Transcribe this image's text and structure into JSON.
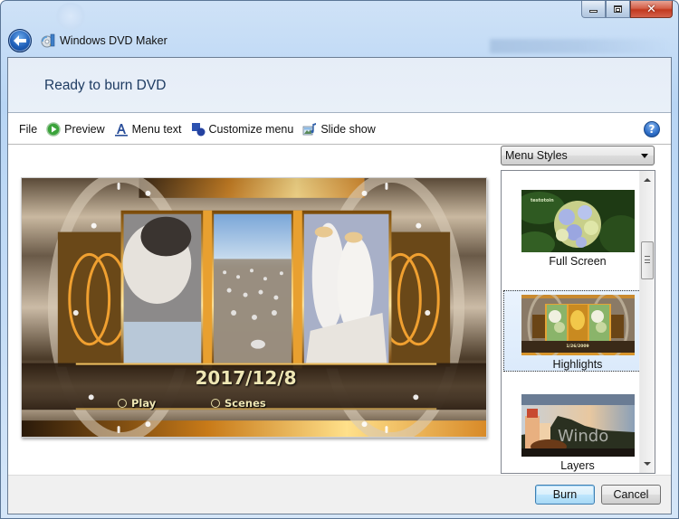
{
  "window": {
    "title": "Windows DVD Maker",
    "controls": {
      "minimize": "minimize",
      "maximize": "maximize",
      "close": "close"
    }
  },
  "header": {
    "title": "Ready to burn DVD"
  },
  "toolbar": {
    "items": [
      {
        "label": "File",
        "icon": "none"
      },
      {
        "label": "Preview",
        "icon": "play-circle-icon"
      },
      {
        "label": "Menu text",
        "icon": "text-a-icon"
      },
      {
        "label": "Customize menu",
        "icon": "shapes-icon"
      },
      {
        "label": "Slide show",
        "icon": "slideshow-icon"
      }
    ],
    "help": "?"
  },
  "preview": {
    "menu_title": "2017/12/8",
    "options": [
      "Play",
      "Scenes"
    ]
  },
  "styles_panel": {
    "dropdown_value": "Menu Styles",
    "items": [
      {
        "label": "Full Screen",
        "selected": false,
        "thumb_caption": "testotoin"
      },
      {
        "label": "Highlights",
        "selected": true,
        "thumb_caption": "1/26/2009"
      },
      {
        "label": "Layers",
        "selected": false,
        "thumb_caption": "Windo"
      }
    ]
  },
  "footer": {
    "burn_label": "Burn",
    "cancel_label": "Cancel"
  }
}
